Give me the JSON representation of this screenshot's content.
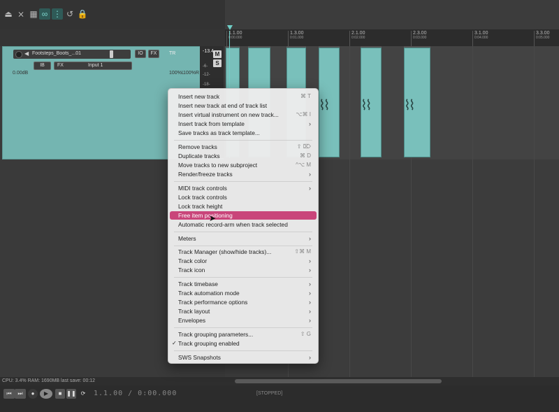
{
  "toolbar": {
    "buttons": [
      "metronome-icon",
      "ripple-icon",
      "grid-icon",
      "snap-icon",
      "grid-dots-icon",
      "loop-icon",
      "lock-icon"
    ]
  },
  "track": {
    "name": "Footsteps_Boots_...01",
    "io_button": "IO",
    "fx_button": "FX",
    "route_label": "TR",
    "input_mode": "IB",
    "fx_chain": "FX",
    "input": "Input 1",
    "volume_db": "0.00dB",
    "pan_left": "100%L",
    "pan_right": "100%R",
    "meter_db": "-13.4",
    "meter_ticks": [
      "-6-",
      "-12-",
      "-18-"
    ],
    "mute": "M",
    "solo": "S"
  },
  "timeline": {
    "ticks": [
      {
        "label": "1.1.00",
        "sub": "0:00.000"
      },
      {
        "label": "1.3.00",
        "sub": "0:01.000"
      },
      {
        "label": "2.1.00",
        "sub": "0:02.000"
      },
      {
        "label": "2.3.00",
        "sub": "0:03.000"
      },
      {
        "label": "3.1.00",
        "sub": "0:04.000"
      },
      {
        "label": "3.3.00",
        "sub": "0:05.000"
      }
    ]
  },
  "menu": {
    "items": [
      {
        "label": "Insert new track",
        "shortcut": "⌘ T"
      },
      {
        "label": "Insert new track at end of track list",
        "shortcut": ""
      },
      {
        "label": "Insert virtual instrument on new track...",
        "shortcut": "⌥⌘ I"
      },
      {
        "label": "Insert track from template",
        "submenu": true
      },
      {
        "label": "Save tracks as track template...",
        "shortcut": ""
      },
      {
        "label": "Remove tracks",
        "shortcut": "⇧ ⌦"
      },
      {
        "label": "Duplicate tracks",
        "shortcut": "⌘ D"
      },
      {
        "label": "Move tracks to new subproject",
        "shortcut": "^⌥ M"
      },
      {
        "label": "Render/freeze tracks",
        "submenu": true
      },
      {
        "label": "MIDI track controls",
        "submenu": true
      },
      {
        "label": "Lock track controls",
        "shortcut": ""
      },
      {
        "label": "Lock track height",
        "shortcut": ""
      },
      {
        "label": "Free item positioning",
        "shortcut": "",
        "highlighted": true
      },
      {
        "label": "Automatic record-arm when track selected",
        "shortcut": ""
      },
      {
        "label": "Meters",
        "submenu": true
      },
      {
        "label": "Track Manager (show/hide tracks)...",
        "shortcut": "⇧⌘ M"
      },
      {
        "label": "Track color",
        "submenu": true
      },
      {
        "label": "Track icon",
        "submenu": true
      },
      {
        "label": "Track timebase",
        "submenu": true
      },
      {
        "label": "Track automation mode",
        "submenu": true
      },
      {
        "label": "Track performance options",
        "submenu": true
      },
      {
        "label": "Track layout",
        "submenu": true
      },
      {
        "label": "Envelopes",
        "submenu": true
      },
      {
        "label": "Track grouping parameters...",
        "shortcut": "⇧ G"
      },
      {
        "label": "Track grouping enabled",
        "shortcut": "",
        "checked": true
      },
      {
        "label": "SWS Snapshots",
        "submenu": true
      }
    ],
    "arrow_glyph": "›",
    "check_glyph": "✓"
  },
  "status": {
    "text": "CPU: 3.4%  RAM: 1690MB  last save: 00:12"
  },
  "transport": {
    "time": "1.1.00 / 0:00.000",
    "state": "[STOPPED]"
  },
  "colors": {
    "track": "#74b5b1",
    "item": "#79c0bb",
    "highlight": "#c9457a",
    "playhead": "#6fcfc7"
  }
}
